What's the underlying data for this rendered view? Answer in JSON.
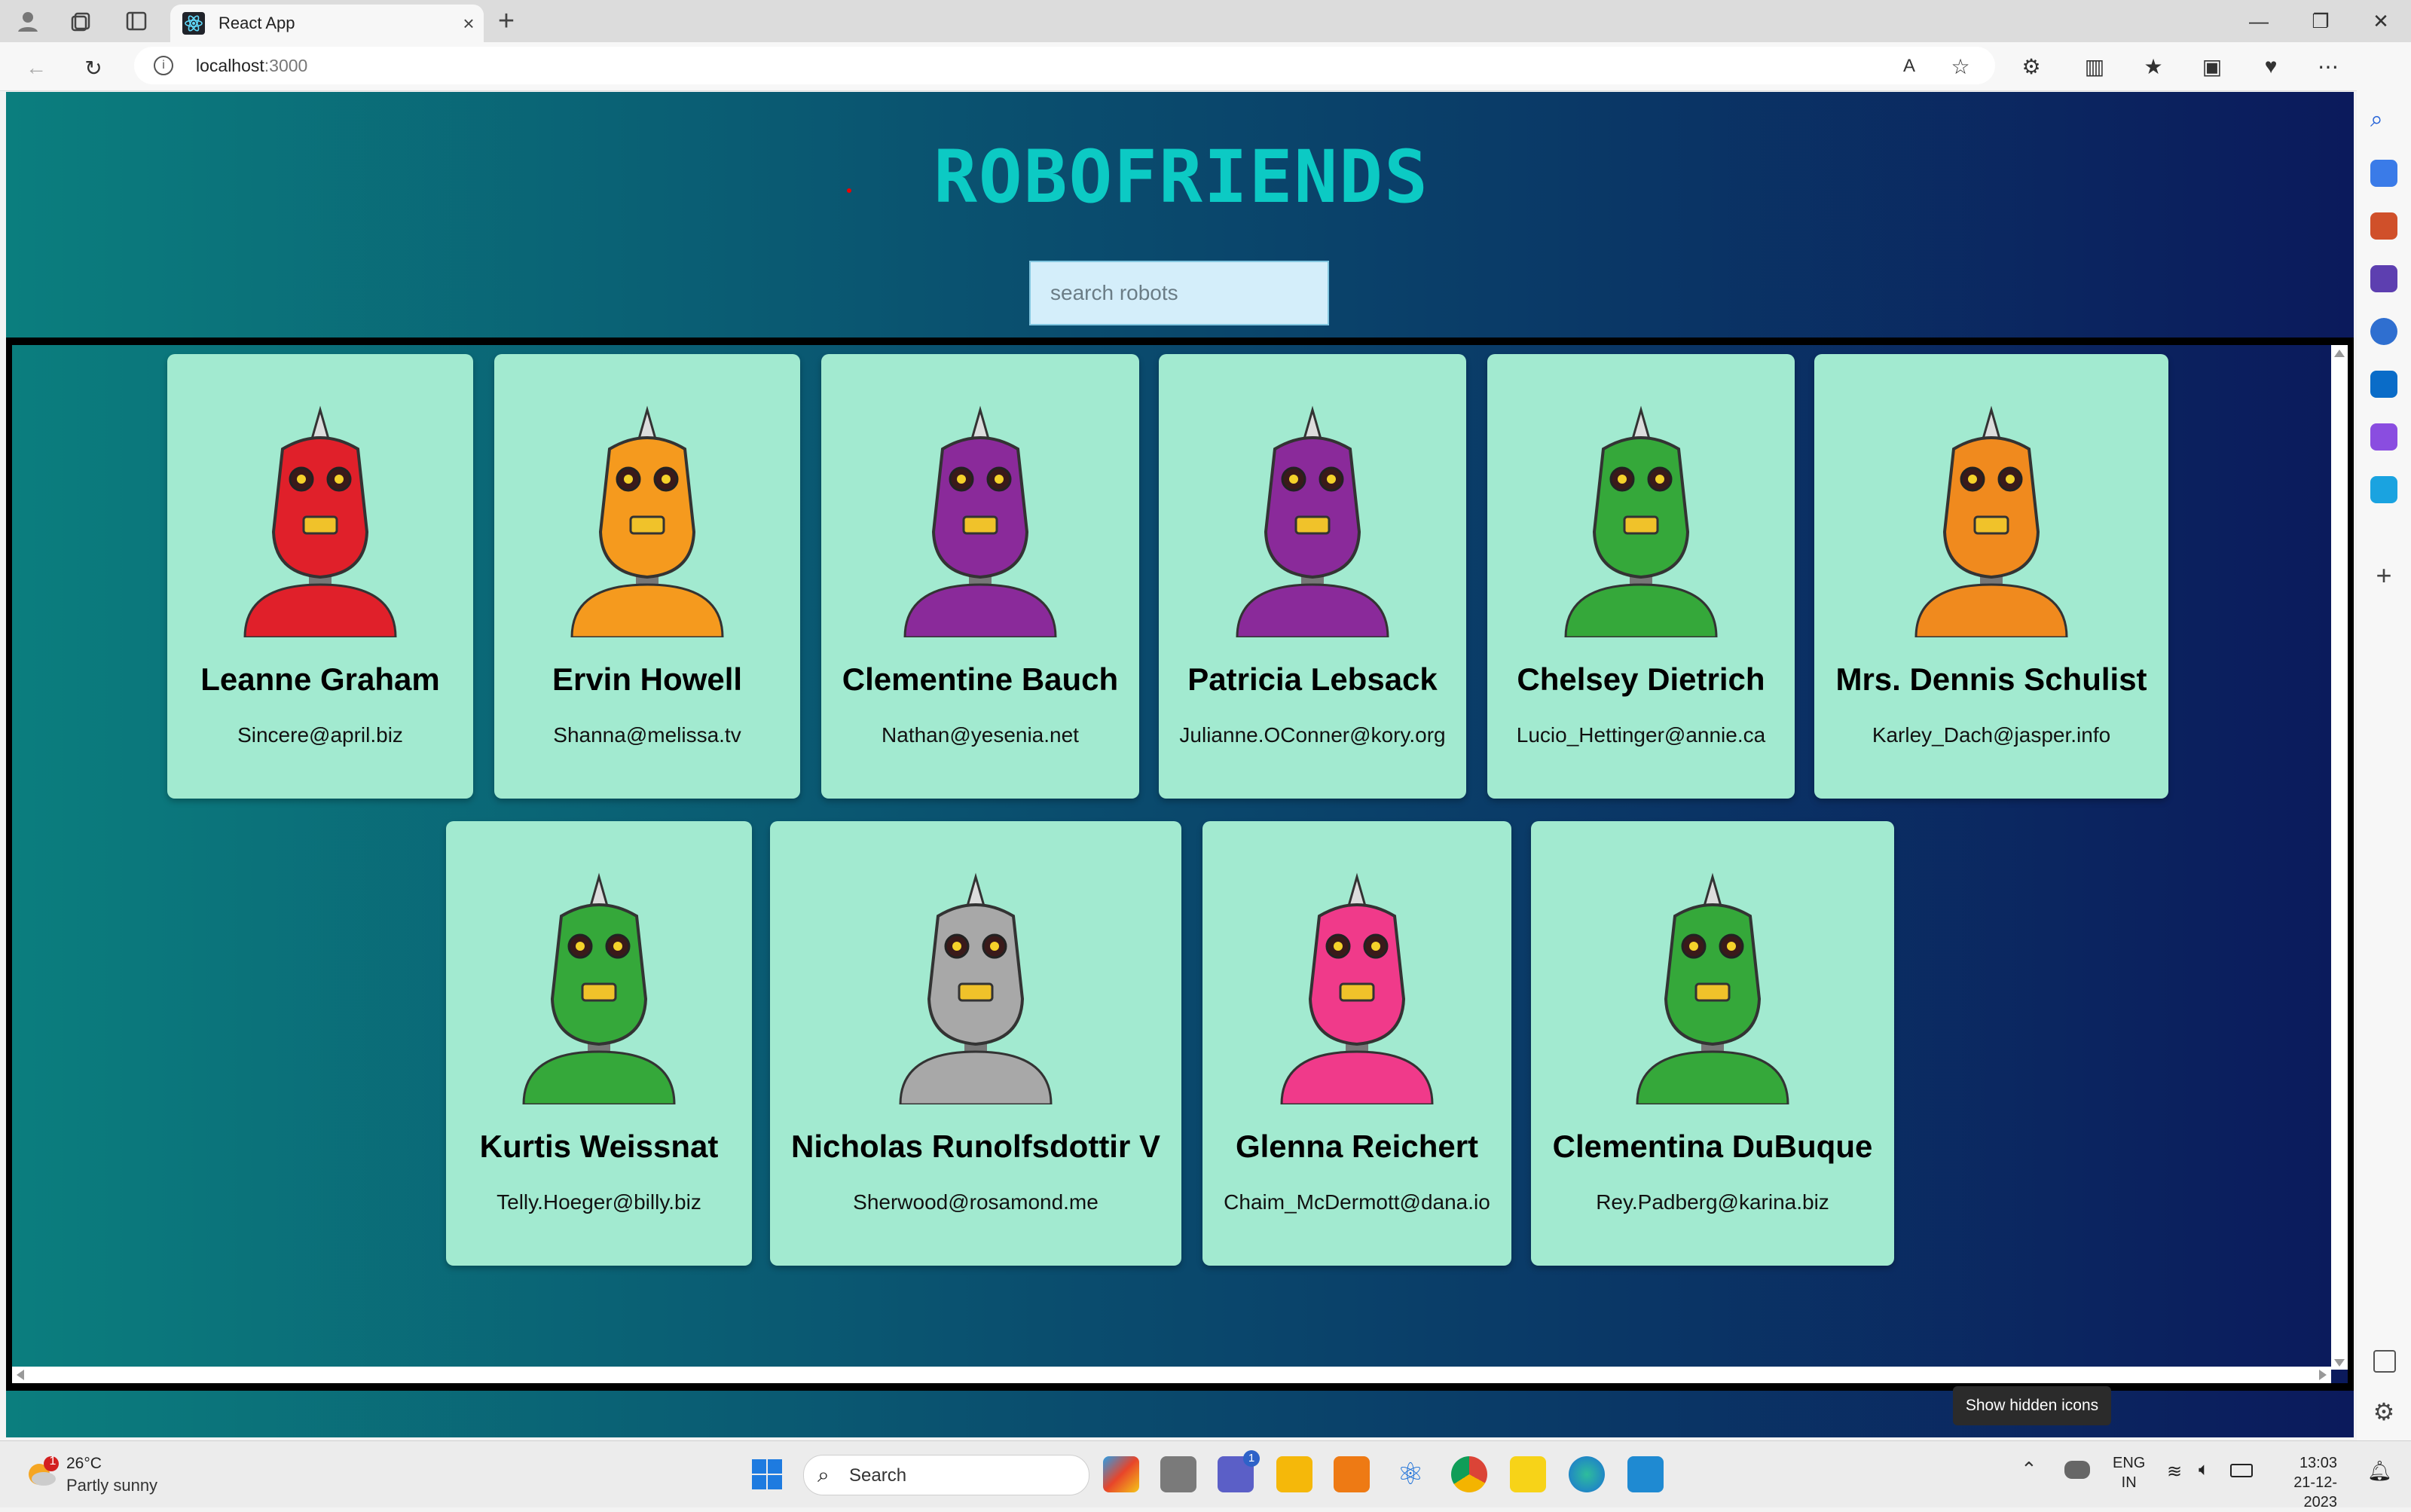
{
  "browser": {
    "tab_title": "React App",
    "url_host": "localhost",
    "url_port": ":3000"
  },
  "app": {
    "logo_text": "ROBOFRIENDS",
    "search_placeholder": "search robots"
  },
  "robots": [
    {
      "name": "Leanne Graham",
      "email": "Sincere@april.biz",
      "color": "#e0202a"
    },
    {
      "name": "Ervin Howell",
      "email": "Shanna@melissa.tv",
      "color": "#f59a1e"
    },
    {
      "name": "Clementine Bauch",
      "email": "Nathan@yesenia.net",
      "color": "#8a2a9a"
    },
    {
      "name": "Patricia Lebsack",
      "email": "Julianne.OConner@kory.org",
      "color": "#8a2a9a"
    },
    {
      "name": "Chelsey Dietrich",
      "email": "Lucio_Hettinger@annie.ca",
      "color": "#35a83a"
    },
    {
      "name": "Mrs. Dennis Schulist",
      "email": "Karley_Dach@jasper.info",
      "color": "#f08a1e"
    },
    {
      "name": "Kurtis Weissnat",
      "email": "Telly.Hoeger@billy.biz",
      "color": "#35a83a"
    },
    {
      "name": "Nicholas Runolfsdottir V",
      "email": "Sherwood@rosamond.me",
      "color": "#a8a8a8"
    },
    {
      "name": "Glenna Reichert",
      "email": "Chaim_McDermott@dana.io",
      "color": "#f03a8a"
    },
    {
      "name": "Clementina DuBuque",
      "email": "Rey.Padberg@karina.biz",
      "color": "#35a83a"
    }
  ],
  "taskbar": {
    "weather_temp": "26°C",
    "weather_desc": "Partly sunny",
    "weather_badge": "1",
    "search_label": "Search",
    "teams_badge": "1",
    "lang_top": "ENG",
    "lang_bottom": "IN",
    "time": "13:03",
    "date": "21-12-2023",
    "tooltip": "Show hidden icons"
  }
}
